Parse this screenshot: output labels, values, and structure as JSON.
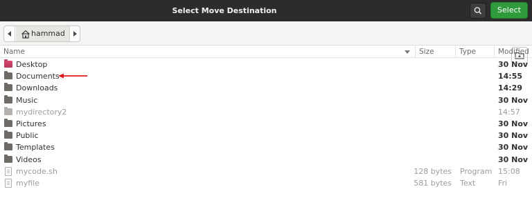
{
  "window": {
    "title": "Select Move Destination",
    "select_label": "Select"
  },
  "pathbar": {
    "current": "hammad"
  },
  "columns": {
    "name": "Name",
    "size": "Size",
    "type": "Type",
    "modified": "Modified"
  },
  "files": [
    {
      "name": "Desktop",
      "size": "",
      "type": "",
      "modified": "30 Nov",
      "kind": "folder-desktop",
      "dim": false
    },
    {
      "name": "Documents",
      "size": "",
      "type": "",
      "modified": "14:55",
      "kind": "folder",
      "dim": false
    },
    {
      "name": "Downloads",
      "size": "",
      "type": "",
      "modified": "14:29",
      "kind": "folder",
      "dim": false
    },
    {
      "name": "Music",
      "size": "",
      "type": "",
      "modified": "30 Nov",
      "kind": "folder",
      "dim": false
    },
    {
      "name": "mydirectory2",
      "size": "",
      "type": "",
      "modified": "14:57",
      "kind": "folder",
      "dim": true
    },
    {
      "name": "Pictures",
      "size": "",
      "type": "",
      "modified": "30 Nov",
      "kind": "folder",
      "dim": false
    },
    {
      "name": "Public",
      "size": "",
      "type": "",
      "modified": "30 Nov",
      "kind": "folder",
      "dim": false
    },
    {
      "name": "Templates",
      "size": "",
      "type": "",
      "modified": "30 Nov",
      "kind": "folder",
      "dim": false
    },
    {
      "name": "Videos",
      "size": "",
      "type": "",
      "modified": "30 Nov",
      "kind": "folder",
      "dim": false
    },
    {
      "name": "mycode.sh",
      "size": "128 bytes",
      "type": "Program",
      "modified": "15:08",
      "kind": "file",
      "dim": true
    },
    {
      "name": "myfile",
      "size": "581 bytes",
      "type": "Text",
      "modified": "Fri",
      "kind": "file",
      "dim": true
    }
  ],
  "colors": {
    "select_button": "#2f9b3c",
    "titlebar": "#2c2c2c",
    "annotation_arrow": "#e01b1b"
  },
  "icons": [
    "search-icon",
    "home-icon",
    "chevron-left-icon",
    "chevron-right-icon",
    "new-folder-icon",
    "folder-icon",
    "file-icon"
  ]
}
